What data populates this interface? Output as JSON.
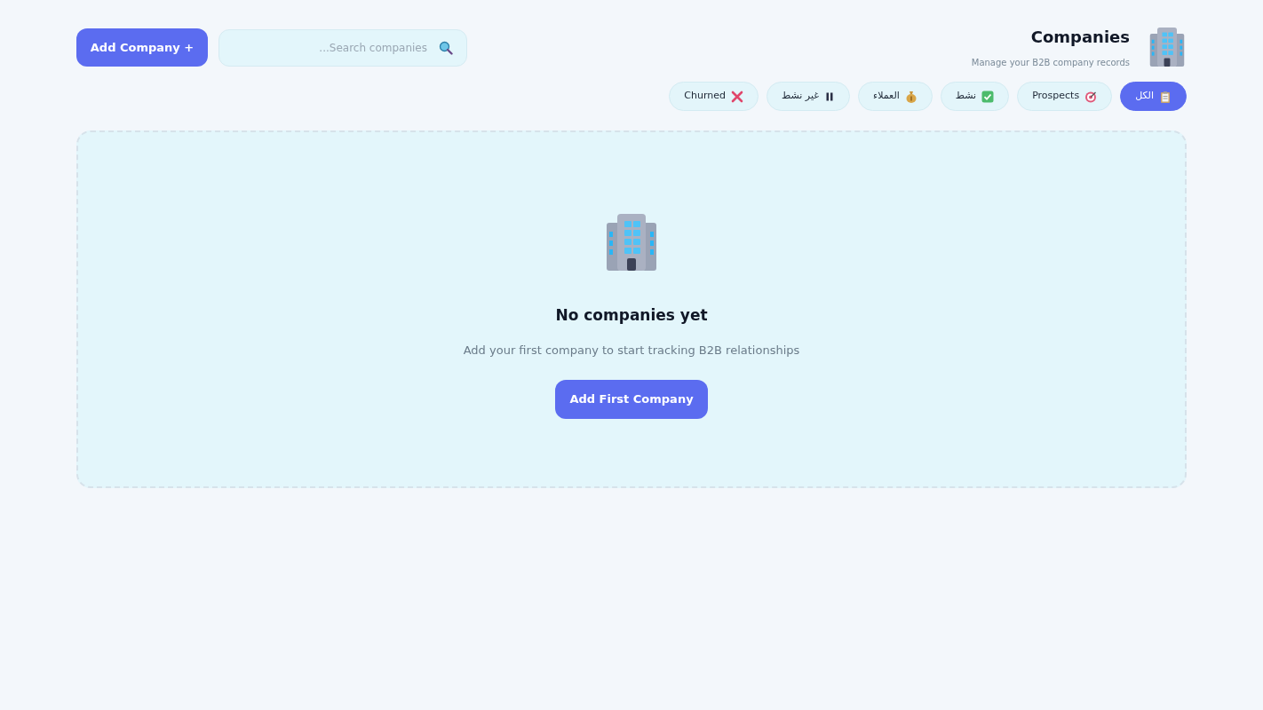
{
  "header": {
    "title": "Companies",
    "subtitle": "Manage your B2B company records",
    "add_button": "Add Company +",
    "search": {
      "placeholder": "...Search companies"
    }
  },
  "filters": [
    {
      "label": "الكل",
      "kind": "all",
      "selected": true
    },
    {
      "label": "Prospects",
      "kind": "prospect",
      "selected": false
    },
    {
      "label": "نشط",
      "kind": "active",
      "selected": false
    },
    {
      "label": "العملاء",
      "kind": "customer",
      "selected": false
    },
    {
      "label": "غير نشط",
      "kind": "inactive",
      "selected": false
    },
    {
      "label": "Churned",
      "kind": "churned",
      "selected": false
    }
  ],
  "empty_state": {
    "title": "No companies yet",
    "message": "Add your first company to start tracking B2B relationships",
    "button": "Add First Company"
  }
}
